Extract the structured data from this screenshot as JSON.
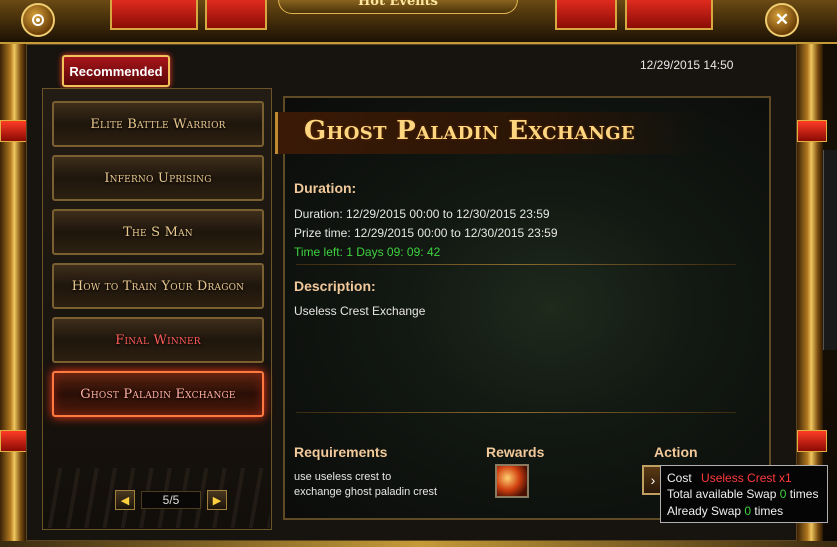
{
  "window": {
    "title": "Hot Events",
    "datetime": "12/29/2015 14:50",
    "recommended_tab": "Recommended"
  },
  "events": [
    {
      "label": "Elite Battle Warrior",
      "active": false
    },
    {
      "label": "Inferno Uprising",
      "active": false
    },
    {
      "label": "The S Man",
      "active": false
    },
    {
      "label": "How to Train Your Dragon",
      "active": false
    },
    {
      "label": "Final Winner",
      "active": false
    },
    {
      "label": "Ghost Paladin Exchange",
      "active": true
    }
  ],
  "pager": {
    "prev": "◀",
    "next": "▶",
    "page": "5/5"
  },
  "detail": {
    "title": "Ghost Paladin Exchange",
    "duration_head": "Duration:",
    "duration_line": "Duration: 12/29/2015 00:00 to 12/30/2015 23:59",
    "prize_line": "Prize time: 12/29/2015 00:00 to 12/30/2015 23:59",
    "time_left": "Time left: 1 Days  09: 09: 42",
    "description_head": "Description:",
    "description": "Useless Crest Exchange",
    "requirements_head": "Requirements",
    "requirements_line1": "use useless crest to",
    "requirements_line2": "exchange ghost paladin crest",
    "rewards_head": "Rewards",
    "action_head": "Action"
  },
  "tooltip": {
    "cost_label": "Cost",
    "cost_item": "Useless Crest x1",
    "total_prefix": "Total available  Swap",
    "total_count": "0",
    "total_suffix": "times",
    "already_prefix": "Already Swap",
    "already_count": "0",
    "already_suffix": "times"
  },
  "colors": {
    "accent_gold": "#ffd680",
    "active_red": "#ff3a18",
    "time_green": "#3ed23e",
    "cost_red": "#ff3a3a"
  },
  "icons": {
    "settings": "gear-icon",
    "close": "close-icon",
    "prev": "arrow-left-icon",
    "next": "arrow-right-icon",
    "reward": "crest-reward-icon",
    "action": "swap-action-icon"
  }
}
